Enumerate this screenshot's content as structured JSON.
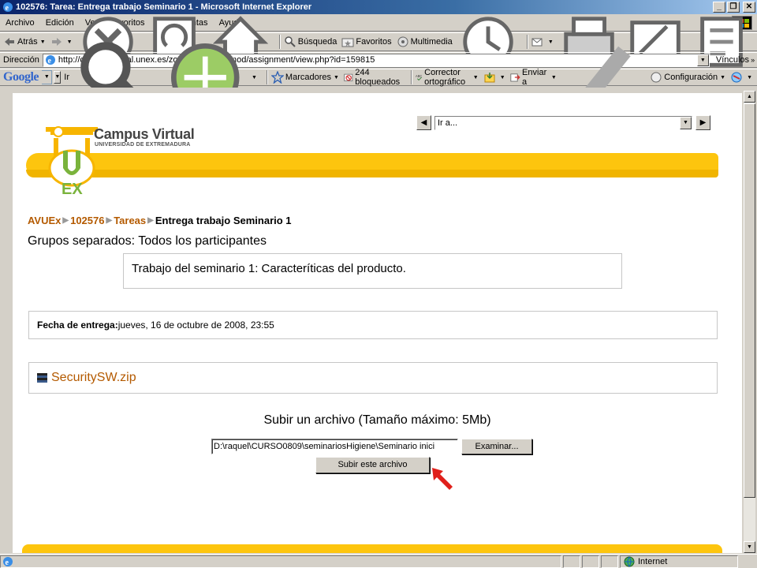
{
  "window": {
    "title": "102576: Tarea: Entrega trabajo Seminario 1 - Microsoft Internet Explorer",
    "minimize": "_",
    "restore": "❐",
    "close": "✕"
  },
  "menu": [
    "Archivo",
    "Edición",
    "Ver",
    "Favoritos",
    "Herramientas",
    "Ayuda"
  ],
  "toolbar": {
    "back": "Atrás",
    "search": "Búsqueda",
    "favorites": "Favoritos",
    "multimedia": "Multimedia"
  },
  "address": {
    "label": "Dirección",
    "url": "http://campusvirtual.unex.es/zonauex/avuex/mod/assignment/view.php?id=159815",
    "links": "Vínculos"
  },
  "google_toolbar": {
    "logo": "Google",
    "go": "Ir",
    "bookmarks": "Marcadores",
    "blocked": "244 bloqueados",
    "spellcheck": "Corrector ortográfico",
    "send": "Enviar a",
    "settings": "Configuración"
  },
  "site": {
    "logo_title": "Campus Virtual",
    "logo_subtitle": "UNIVERSIDAD DE EXTREMADURA",
    "logo_ex": "EX",
    "jump_menu": "Ir a..."
  },
  "breadcrumb": {
    "items": [
      "AVUEx",
      "102576",
      "Tareas"
    ],
    "current": "Entrega trabajo Seminario 1"
  },
  "groups_label": "Grupos separados: Todos los participantes",
  "assignment": {
    "intro": "Trabajo del seminario 1: Caracteríticas del producto.",
    "due_label": "Fecha de entrega:",
    "due_value": "jueves, 16 de octubre de 2008, 23:55",
    "file_name": "SecuritySW.zip"
  },
  "upload": {
    "title": "Subir un archivo (Tamaño máximo: 5Mb)",
    "file_value": "D:\\raquel\\CURSO0809\\seminariosHigiene\\Seminario inici",
    "browse_label": "Examinar...",
    "submit_label": "Subir este archivo"
  },
  "status": {
    "zone": "Internet"
  },
  "colors": {
    "accent_yellow": "#fdc50e",
    "link_orange": "#b45a00",
    "logo_green": "#7ab33c"
  }
}
